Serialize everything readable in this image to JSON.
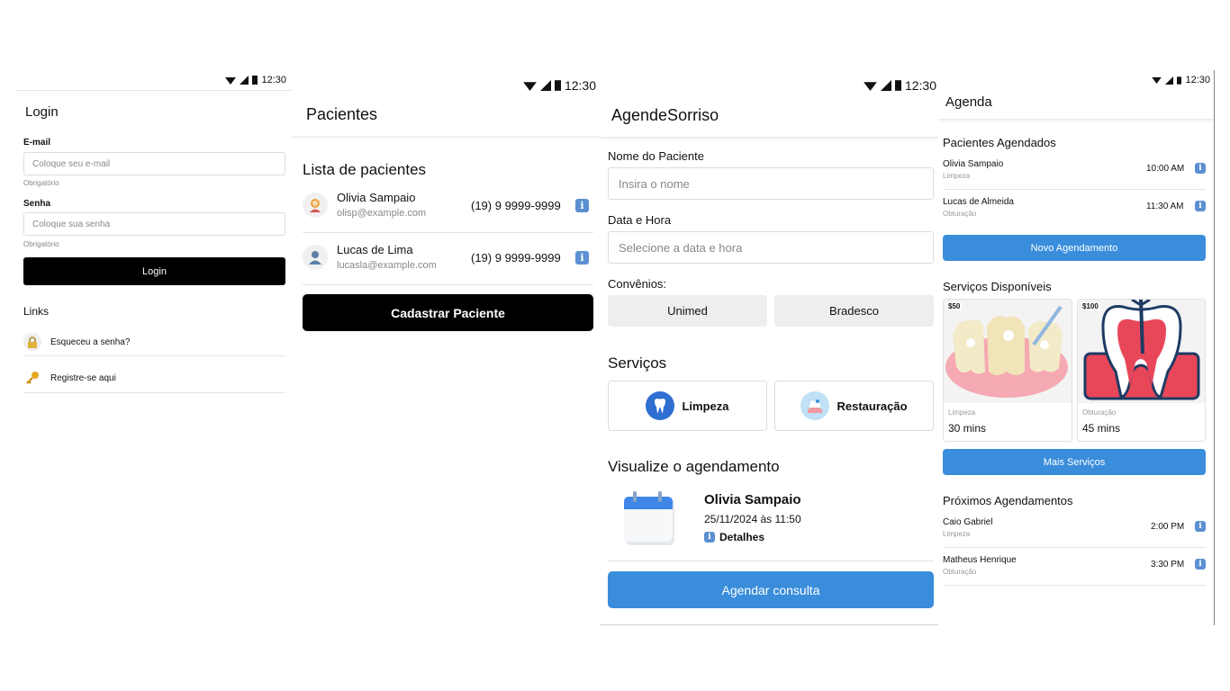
{
  "status_time": "12:30",
  "login": {
    "title": "Login",
    "email_label": "E-mail",
    "email_placeholder": "Coloque seu e-mail",
    "email_hint": "Obrigatório",
    "password_label": "Senha",
    "password_placeholder": "Coloque sua senha",
    "password_hint": "Obrigatório",
    "login_button": "Login",
    "links_title": "Links",
    "links": [
      {
        "label": "Esqueceu a senha?",
        "icon": "lock-icon"
      },
      {
        "label": "Registre-se aqui",
        "icon": "key-icon"
      }
    ]
  },
  "patients": {
    "title": "Pacientes",
    "list_title": "Lista de pacientes",
    "items": [
      {
        "name": "Olivia Sampaio",
        "email": "olisp@example.com",
        "phone": "(19) 9 9999-9999"
      },
      {
        "name": "Lucas de Lima",
        "email": "lucasla@example.com",
        "phone": "(19) 9 9999-9999"
      }
    ],
    "register_button": "Cadastrar Paciente"
  },
  "schedule": {
    "title": "AgendeSorriso",
    "patient_label": "Nome do Paciente",
    "patient_placeholder": "Insira o nome",
    "datetime_label": "Data e Hora",
    "datetime_placeholder": "Selecione a data e hora",
    "insurance_label": "Convênios:",
    "insurances": [
      "Unimed",
      "Bradesco"
    ],
    "services_title": "Serviços",
    "services": [
      "Limpeza",
      "Restauração"
    ],
    "preview_title": "Visualize o agendamento",
    "preview": {
      "name": "Olivia Sampaio",
      "datetime": "25/11/2024 às 11:50",
      "details": "Detalhes"
    },
    "submit_button": "Agendar consulta"
  },
  "agenda": {
    "title": "Agenda",
    "scheduled_title": "Pacientes Agendados",
    "scheduled": [
      {
        "name": "Olivia Sampaio",
        "service": "Limpeza",
        "time": "10:00 AM"
      },
      {
        "name": "Lucas de Almeida",
        "service": "Obturação",
        "time": "11:30 AM"
      }
    ],
    "new_button": "Novo Agendamento",
    "services_title": "Serviços Disponíveis",
    "services": [
      {
        "price": "$50",
        "name": "Limpeza",
        "duration": "30 mins"
      },
      {
        "price": "$100",
        "name": "Obturação",
        "duration": "45 mins"
      }
    ],
    "more_button": "Mais Serviços",
    "upcoming_title": "Próximos Agendamentos",
    "upcoming": [
      {
        "name": "Caio Gabriel",
        "service": "Limpeza",
        "time": "2:00 PM"
      },
      {
        "name": "Matheus Henrique",
        "service": "Obturação",
        "time": "3:30 PM"
      }
    ]
  },
  "colors": {
    "accent_blue": "#3a8ddb",
    "black_button": "#000000",
    "info_icon": "#5b8fd1"
  }
}
